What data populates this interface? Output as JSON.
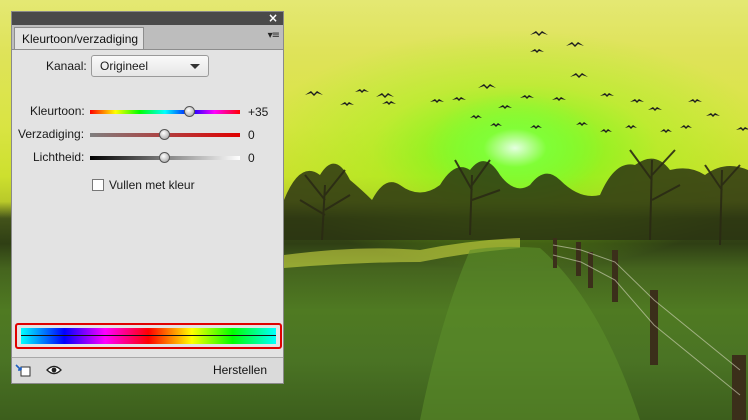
{
  "panel": {
    "tab_label": "Kleurtoon/verzadiging",
    "close_glyph": "×",
    "menu_glyph": "▾≡",
    "channel": {
      "label": "Kanaal:",
      "value": "Origineel"
    },
    "sliders": {
      "hue": {
        "label": "Kleurtoon:",
        "value": "+35",
        "level": 0.666
      },
      "saturation": {
        "label": "Verzadiging:",
        "value": "0",
        "level": 0.5
      },
      "lightness": {
        "label": "Lichtheid:",
        "value": "0",
        "level": 0.5
      }
    },
    "colorize": {
      "label": "Vullen met kleur",
      "checked": false
    },
    "ramp_highlight_color": "#e00000",
    "footer": {
      "clip_icon": "clip-to-layer-icon",
      "eye_icon": "eye-icon",
      "reset_label": "Herstellen"
    }
  }
}
